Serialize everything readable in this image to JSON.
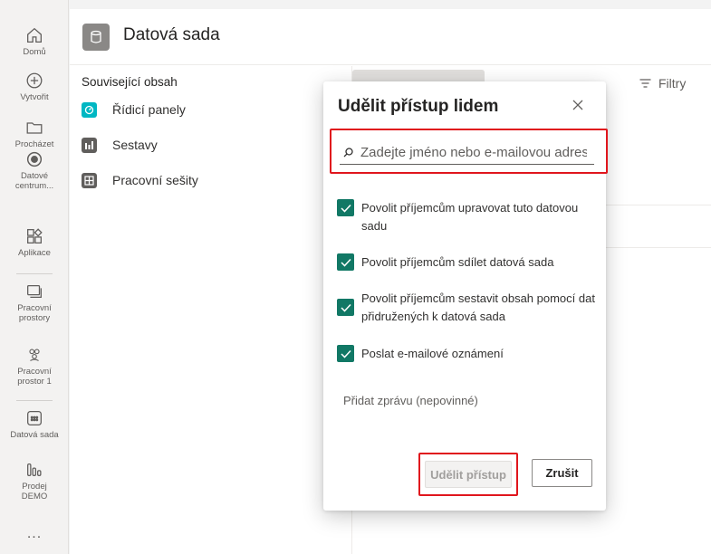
{
  "nav": {
    "items": [
      {
        "label": "Domů",
        "icon": "home-icon"
      },
      {
        "label": "Vytvořit",
        "icon": "create-icon"
      },
      {
        "label": "Procházet",
        "icon": "browse-folder-icon"
      },
      {
        "label": "Datové centrum...",
        "icon": "data-hub-icon"
      },
      {
        "label": "Aplikace",
        "icon": "apps-icon"
      },
      {
        "label": "Pracovní prostory",
        "icon": "workspaces-icon"
      },
      {
        "label": "Pracovní prostor 1",
        "icon": "workspace-icon"
      },
      {
        "label": "Datová sada",
        "icon": "dataset-icon"
      },
      {
        "label": "Prodej DEMO",
        "icon": "report-icon"
      },
      {
        "label": "...",
        "icon": "more-icon"
      }
    ]
  },
  "header": {
    "title": "Datová sada",
    "icon": "dataset-icon"
  },
  "related": {
    "heading": "Související obsah",
    "items": [
      {
        "label": "Řídicí panely",
        "icon": "dashboard-icon",
        "color": "#00b7c3"
      },
      {
        "label": "Sestavy",
        "icon": "report-icon",
        "color": "#605e5c"
      },
      {
        "label": "Pracovní sešity",
        "icon": "workbook-icon",
        "color": "#605e5c"
      }
    ]
  },
  "toolbar": {
    "filters_label": "Filtry"
  },
  "dialog": {
    "title": "Udělit přístup lidem",
    "search_placeholder": "Zadejte jméno nebo e-mailovou adresu",
    "options": [
      {
        "label": "Povolit příjemcům upravovat tuto datovou sadu",
        "checked": true
      },
      {
        "label": "Povolit příjemcům sdílet datová sada",
        "checked": true
      },
      {
        "label": "Povolit příjemcům sestavit obsah pomocí dat přidružených k datová sada",
        "checked": true
      },
      {
        "label": "Poslat e-mailové oznámení",
        "checked": true
      }
    ],
    "message_placeholder": "Přidat zprávu (nepovinné)",
    "grant_label": "Udělit přístup",
    "cancel_label": "Zrušit"
  },
  "colors": {
    "checkbox": "#117865",
    "highlight": "#e0161d"
  }
}
